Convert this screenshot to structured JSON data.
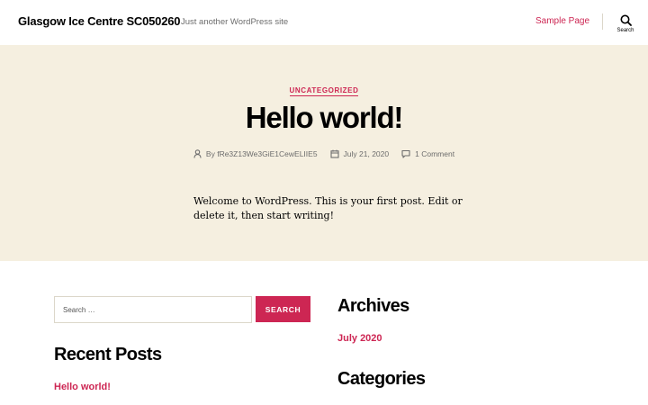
{
  "header": {
    "site_title": "Glasgow Ice Centre SC050260",
    "site_description": "Just another WordPress site",
    "nav": [
      {
        "label": "Sample Page"
      }
    ],
    "search_toggle_label": "Search"
  },
  "post": {
    "category": "UNCATEGORIZED",
    "title": "Hello world!",
    "meta": {
      "author": "By fRe3Z13We3GiE1CewELIIE5",
      "date": "July 21, 2020",
      "comments": "1 Comment"
    },
    "content": "Welcome to WordPress. This is your first post. Edit or delete it, then start writing!"
  },
  "widgets": {
    "search": {
      "placeholder": "Search …",
      "button_label": "SEARCH"
    },
    "recent_posts": {
      "title": "Recent Posts",
      "items": [
        {
          "label": "Hello world!"
        }
      ]
    },
    "archives": {
      "title": "Archives",
      "items": [
        {
          "label": "July 2020"
        }
      ]
    },
    "categories": {
      "title": "Categories"
    }
  },
  "colors": {
    "accent": "#cd2653",
    "hero_background": "#f5efe0",
    "meta_text": "#6d6d6d"
  },
  "icons": [
    "person-icon",
    "calendar-icon",
    "comment-icon",
    "search-icon"
  ]
}
